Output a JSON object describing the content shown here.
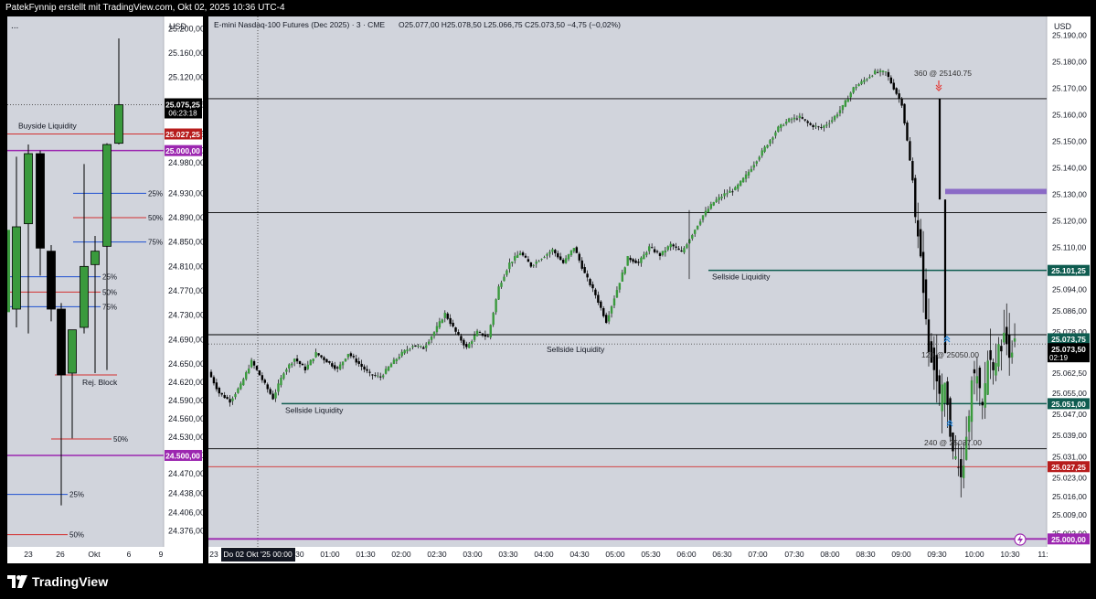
{
  "header": {
    "title": "PatekFynnip erstellt mit TradingView.com, Okt 02, 2025 10:36 UTC-4"
  },
  "footer": {
    "brand": "TradingView"
  },
  "left_pane": {
    "menu": "...",
    "currency": "USD",
    "time_labels": [
      "23",
      "26",
      "Okt",
      "6",
      "9"
    ],
    "annotations": {
      "buyside": "Buyside Liquidity",
      "rej_block": "Rej. Block"
    },
    "current_price": "25.075,25",
    "countdown": "06:23:18",
    "price_tags": [
      {
        "label": "25.027,25",
        "value": 25027.25,
        "color": "#b71c1c"
      },
      {
        "label": "25.000,00",
        "value": 25000.0,
        "color": "#9c27b0"
      },
      {
        "label": "24.500,00",
        "value": 24500.0,
        "color": "#9c27b0"
      }
    ]
  },
  "right_pane": {
    "currency": "USD",
    "legend": {
      "symbol": "E-mini Nasdaq-100 Futures (Dec 2025) · 3 · CME",
      "ohlc": "O25.077,00  H25.078,50  L25.066,75  C25.073,50  −4,75 (−0,02%)"
    },
    "time_labels": [
      "23",
      "00:30",
      "01:00",
      "01:30",
      "02:00",
      "02:30",
      "03:00",
      "03:30",
      "04:00",
      "04:30",
      "05:00",
      "05:30",
      "06:00",
      "06:30",
      "07:00",
      "07:30",
      "08:00",
      "08:30",
      "09:00",
      "09:30",
      "10:00",
      "10:30",
      "11:"
    ],
    "crosshair_date": "Do 02 Okt '25  00:00",
    "annotations": {
      "sellside_1": "Sellside Liquidity",
      "sellside_2": "Sellside Liquidity",
      "sellside_3": "Sellside Liquidity",
      "marker_360": "360 @ 25140.75",
      "marker_120": "120 @ 25050.00",
      "marker_240": "240 @ 25037.00"
    },
    "current_price": "25.073,50",
    "countdown": "02:19",
    "price_tags": [
      {
        "label": "25.101,25",
        "value": 25101.25,
        "color": "#0f5c50"
      },
      {
        "label": "25.073,75",
        "value": 25073.75,
        "color": "#0f5c50"
      },
      {
        "label": "25.051,00",
        "value": 25051.0,
        "color": "#0f5c50"
      },
      {
        "label": "25.027,25",
        "value": 25027.25,
        "color": "#b71c1c"
      },
      {
        "label": "25.000,00",
        "value": 25000.0,
        "color": "#9c27b0"
      }
    ]
  },
  "chart_data": [
    {
      "type": "candlestick",
      "name": "left-daily-pane",
      "x_labels": [
        "23",
        "26",
        "Okt",
        "6",
        "9"
      ],
      "y_ticks": [
        "25.200,00",
        "25.160,00",
        "25.120,00",
        "25.075,25",
        "25.027,25",
        "25.000,00",
        "24.980,00",
        "24.930,00",
        "24.890,00",
        "24.850,00",
        "24.810,00",
        "24.770,00",
        "24.730,00",
        "24.690,00",
        "24.650,00",
        "24.620,00",
        "24.590,00",
        "24.560,00",
        "24.530,00",
        "24.500,00",
        "24.470,00",
        "24.438,00",
        "24.406,00",
        "24.376,00"
      ],
      "ylim": [
        24350,
        25220
      ],
      "candles": [
        {
          "o": 24740,
          "h": 24990,
          "l": 24710,
          "c": 24875
        },
        {
          "o": 24880,
          "h": 25010,
          "l": 24700,
          "c": 24995
        },
        {
          "o": 24995,
          "h": 25000,
          "l": 24795,
          "c": 24840
        },
        {
          "o": 24835,
          "h": 24845,
          "l": 24720,
          "c": 24740
        },
        {
          "o": 24740,
          "h": 24750,
          "l": 24418,
          "c": 24632
        },
        {
          "o": 24635,
          "h": 24700,
          "l": 24528,
          "c": 24706
        },
        {
          "o": 24710,
          "h": 24978,
          "l": 24700,
          "c": 24810
        },
        {
          "o": 24813,
          "h": 24860,
          "l": 24635,
          "c": 24835
        },
        {
          "o": 24843,
          "h": 25012,
          "l": 24640,
          "c": 25010
        },
        {
          "o": 25012,
          "h": 25184,
          "l": 25010,
          "c": 25075.25
        }
      ],
      "levels": [
        {
          "value": 25075.25,
          "style": "dotted",
          "color": "#555555"
        },
        {
          "value": 25027.25,
          "color": "#d32f2f"
        },
        {
          "value": 25000.0,
          "color": "#9c27b0"
        },
        {
          "value": 24930,
          "color": "#1e4fd0",
          "label": "25%"
        },
        {
          "value": 24890,
          "color": "#d32f2f",
          "label": "50%"
        },
        {
          "value": 24850,
          "color": "#1e4fd0",
          "label": "75%"
        },
        {
          "value": 24793,
          "color": "#1e4fd0",
          "label": "25%"
        },
        {
          "value": 24768,
          "color": "#d32f2f",
          "label": "50%"
        },
        {
          "value": 24744,
          "color": "#1e4fd0",
          "label": "75%"
        },
        {
          "value": 24632,
          "color": "#d32f2f"
        },
        {
          "value": 24527,
          "color": "#d32f2f",
          "label": "50%"
        },
        {
          "value": 24500.0,
          "color": "#9c27b0"
        },
        {
          "value": 24436,
          "color": "#1e4fd0",
          "label": "25%"
        },
        {
          "value": 24370,
          "color": "#d32f2f",
          "label": "50%"
        }
      ]
    },
    {
      "type": "candlestick",
      "name": "right-3min-pane",
      "title": "E-mini Nasdaq-100 Futures (Dec 2025) · 3 · CME",
      "x_labels": [
        "23",
        "00:30",
        "01:00",
        "01:30",
        "02:00",
        "02:30",
        "03:00",
        "03:30",
        "04:00",
        "04:30",
        "05:00",
        "05:30",
        "06:00",
        "06:30",
        "07:00",
        "07:30",
        "08:00",
        "08:30",
        "09:00",
        "09:30",
        "10:00",
        "10:30",
        "11:"
      ],
      "y_ticks": [
        "25.190,00",
        "25.180,00",
        "25.170,00",
        "25.160,00",
        "25.150,00",
        "25.140,00",
        "25.130,00",
        "25.120,00",
        "25.110,00",
        "25.101,25",
        "25.094,00",
        "25.086,00",
        "25.078,00",
        "25.073,50",
        "25.062,50",
        "25.055,00",
        "25.051,00",
        "25.047,00",
        "25.039,00",
        "25.031,00",
        "25.027,25",
        "25.023,00",
        "25.016,00",
        "25.009,00",
        "25.002,00",
        "25.000,00"
      ],
      "ylim": [
        24997,
        25197
      ],
      "path": [
        [
          0,
          25063
        ],
        [
          4,
          25055
        ],
        [
          8,
          25052
        ],
        [
          12,
          25058
        ],
        [
          16,
          25067
        ],
        [
          20,
          25060
        ],
        [
          24,
          25053
        ],
        [
          28,
          25063
        ],
        [
          32,
          25068
        ],
        [
          36,
          25064
        ],
        [
          40,
          25070
        ],
        [
          44,
          25067
        ],
        [
          48,
          25064
        ],
        [
          52,
          25070
        ],
        [
          56,
          25066
        ],
        [
          60,
          25062
        ],
        [
          64,
          25061
        ],
        [
          68,
          25066
        ],
        [
          72,
          25070
        ],
        [
          76,
          25073
        ],
        [
          80,
          25072
        ],
        [
          84,
          25078
        ],
        [
          88,
          25085
        ],
        [
          92,
          25078
        ],
        [
          96,
          25072
        ],
        [
          100,
          25078
        ],
        [
          104,
          25076
        ],
        [
          108,
          25095
        ],
        [
          112,
          25104
        ],
        [
          116,
          25108
        ],
        [
          120,
          25103
        ],
        [
          124,
          25106
        ],
        [
          128,
          25109
        ],
        [
          132,
          25104
        ],
        [
          136,
          25110
        ],
        [
          140,
          25100
        ],
        [
          144,
          25092
        ],
        [
          148,
          25082
        ],
        [
          152,
          25094
        ],
        [
          156,
          25106
        ],
        [
          160,
          25104
        ],
        [
          164,
          25110
        ],
        [
          168,
          25107
        ],
        [
          172,
          25111
        ],
        [
          176,
          25108
        ],
        [
          180,
          25115
        ],
        [
          184,
          25122
        ],
        [
          188,
          25127
        ],
        [
          192,
          25130
        ],
        [
          196,
          25132
        ],
        [
          200,
          25137
        ],
        [
          204,
          25143
        ],
        [
          208,
          25149
        ],
        [
          212,
          25155
        ],
        [
          216,
          25158
        ],
        [
          220,
          25159
        ],
        [
          224,
          25156
        ],
        [
          228,
          25155
        ],
        [
          232,
          25158
        ],
        [
          236,
          25163
        ],
        [
          240,
          25170
        ],
        [
          244,
          25173
        ],
        [
          248,
          25176
        ],
        [
          252,
          25176
        ],
        [
          256,
          25168
        ],
        [
          258,
          25164
        ],
        [
          260,
          25150
        ],
        [
          262,
          25135
        ],
        [
          264,
          25113
        ],
        [
          266,
          25095
        ],
        [
          268,
          25072
        ],
        [
          270,
          25065
        ],
        [
          272,
          25053
        ],
        [
          274,
          25058
        ],
        [
          276,
          25040
        ],
        [
          278,
          25030
        ],
        [
          280,
          25022
        ],
        [
          282,
          25036
        ],
        [
          284,
          25062
        ],
        [
          286,
          25060
        ],
        [
          288,
          25049
        ],
        [
          290,
          25068
        ],
        [
          292,
          25066
        ],
        [
          294,
          25071
        ],
        [
          296,
          25076
        ],
        [
          298,
          25071
        ],
        [
          300,
          25073.5
        ]
      ],
      "levels": [
        {
          "value": 25166,
          "color": "#000000"
        },
        {
          "value": 25123,
          "color": "#000000"
        },
        {
          "value": 25101.25,
          "color": "#0f5c50"
        },
        {
          "value": 25077,
          "color": "#000000"
        },
        {
          "value": 25073.5,
          "style": "dotted",
          "color": "#555555"
        },
        {
          "value": 25051.0,
          "color": "#0f5c50"
        },
        {
          "value": 25034,
          "color": "#000000"
        },
        {
          "value": 25027.25,
          "color": "#d32f2f"
        },
        {
          "value": 25000.0,
          "color": "#9c27b0"
        }
      ],
      "fvg_zone": [
        25130,
        25132
      ]
    }
  ]
}
